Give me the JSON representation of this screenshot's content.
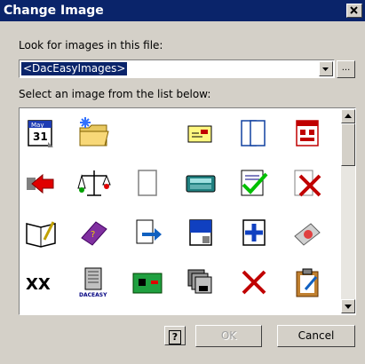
{
  "window": {
    "title": "Change Image"
  },
  "source": {
    "label": "Look for images in this file:",
    "selected": "<DacEasyImages>",
    "browse_label": "..."
  },
  "list": {
    "label": "Select an image from the list below:",
    "icons": [
      "calendar-icon",
      "folder-icon",
      "",
      "envelope-icon",
      "pages-icon",
      "calendar-red-icon",
      "arrow-red-icon",
      "scales-icon",
      "blank-page-icon",
      "keyboard-icon",
      "checkmark-doc-icon",
      "cancel-doc-icon",
      "open-book-icon",
      "book-purple-icon",
      "doc-arrow-icon",
      "doc-blue-icon",
      "doc-plus-icon",
      "stamp-icon",
      "xx-text-icon",
      "dac-building-icon",
      "circuit-icon",
      "stacked-disks-icon",
      "red-x-icon",
      "clipboard-icon"
    ],
    "xx_text": "XX",
    "dac_text": "DACEASY",
    "cal_text": "May",
    "cal_day": "31"
  },
  "buttons": {
    "help": "?",
    "ok": "OK",
    "cancel": "Cancel"
  },
  "colors": {
    "title_bg": "#0a246a",
    "face": "#d4d0c8",
    "selection": "#0a246a"
  }
}
